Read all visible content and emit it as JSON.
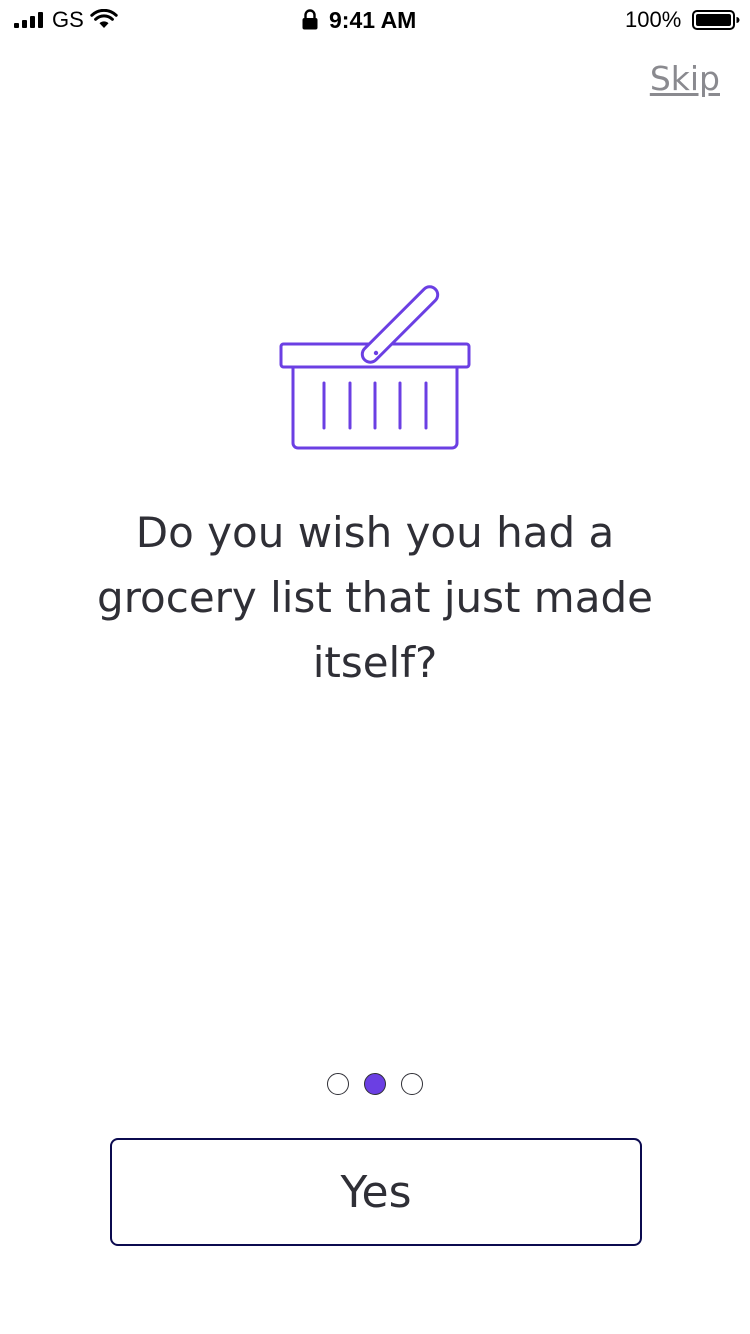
{
  "status_bar": {
    "carrier": "GS",
    "time": "9:41 AM",
    "battery": "100%",
    "icons": [
      "signal-icon",
      "wifi-icon",
      "lock-icon",
      "battery-icon"
    ]
  },
  "header": {
    "skip_label": "Skip"
  },
  "main": {
    "illustration": "basket-icon",
    "headline": "Do you wish you had a grocery list that just made itself?"
  },
  "pager": {
    "total": 3,
    "active_index": 1
  },
  "footer": {
    "yes_label": "Yes"
  },
  "colors": {
    "accent": "#6b3fe3",
    "button_border": "#0b0a4f",
    "text": "#2f2f36",
    "link": "#8a8a8f"
  }
}
